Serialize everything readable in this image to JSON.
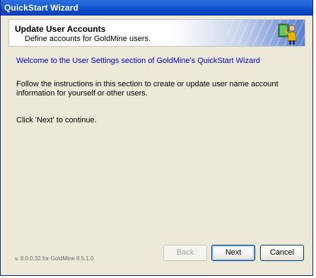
{
  "window": {
    "title": "QuickStart Wizard"
  },
  "header": {
    "title": "Update User Accounts",
    "subtitle": "Define accounts for GoldMine users.",
    "icon": "user-settings-icon"
  },
  "body": {
    "welcome": "Welcome to the User Settings section of GoldMine's QuickStart Wizard",
    "instructions": "Follow the instructions in this section to create or update user name account information for yourself or other users.",
    "click_next": "Click 'Next' to continue."
  },
  "footer": {
    "version": "v. 8.0.0.32 for GoldMine 8.5.1.0",
    "back_label": "Back",
    "next_label": "Next",
    "cancel_label": "Cancel"
  },
  "colors": {
    "titlebar": "#0a47c4",
    "dialog_bg": "#ece9d8",
    "welcome_text": "#0000c8",
    "disabled_text": "#a7a6a0"
  }
}
